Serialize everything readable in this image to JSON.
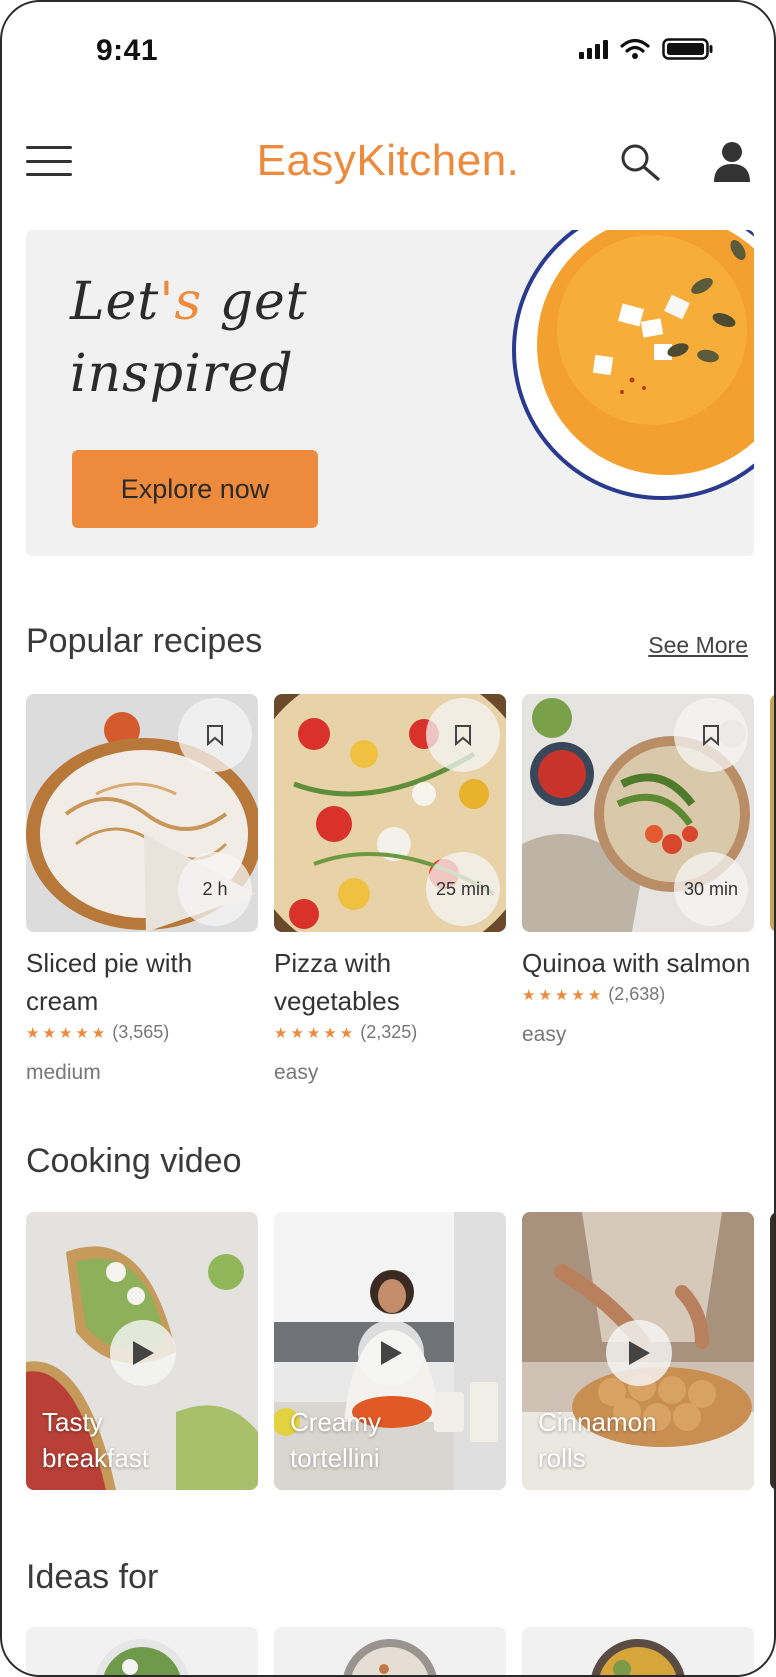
{
  "status_bar": {
    "time": "9:41",
    "icons": [
      "signal-icon",
      "wifi-icon",
      "battery-icon"
    ]
  },
  "header": {
    "logo_part1": "Easy",
    "logo_part2": "Kitchen.",
    "icons": [
      "menu-icon",
      "search-icon",
      "user-icon"
    ]
  },
  "hero": {
    "title_line1_a": "Let",
    "title_line1_b": "'s",
    "title_line1_c": " get",
    "title_line2": "inspired",
    "button_label": "Explore now"
  },
  "popular": {
    "title": "Popular recipes",
    "see_more": "See More",
    "items": [
      {
        "title": "Sliced pie with cream",
        "time": "2 h",
        "rating": "(3,565)",
        "stars": 5,
        "level": "medium"
      },
      {
        "title": "Pizza with vegetables",
        "time": "25 min",
        "rating": "(2,325)",
        "stars": 5,
        "level": "easy"
      },
      {
        "title": "Quinoa with salmon",
        "time": "30 min",
        "rating": "(2,638)",
        "stars": 5,
        "level": "easy"
      }
    ]
  },
  "videos": {
    "title": "Cooking video",
    "items": [
      {
        "label": "Tasty breakfast"
      },
      {
        "label": "Creamy tortellini"
      },
      {
        "label": "Cinnamon rolls"
      }
    ]
  },
  "ideas": {
    "title": "Ideas for"
  },
  "colors": {
    "accent": "#ee8a3c",
    "text": "#333333",
    "hero_bg": "#f1f1f1"
  }
}
